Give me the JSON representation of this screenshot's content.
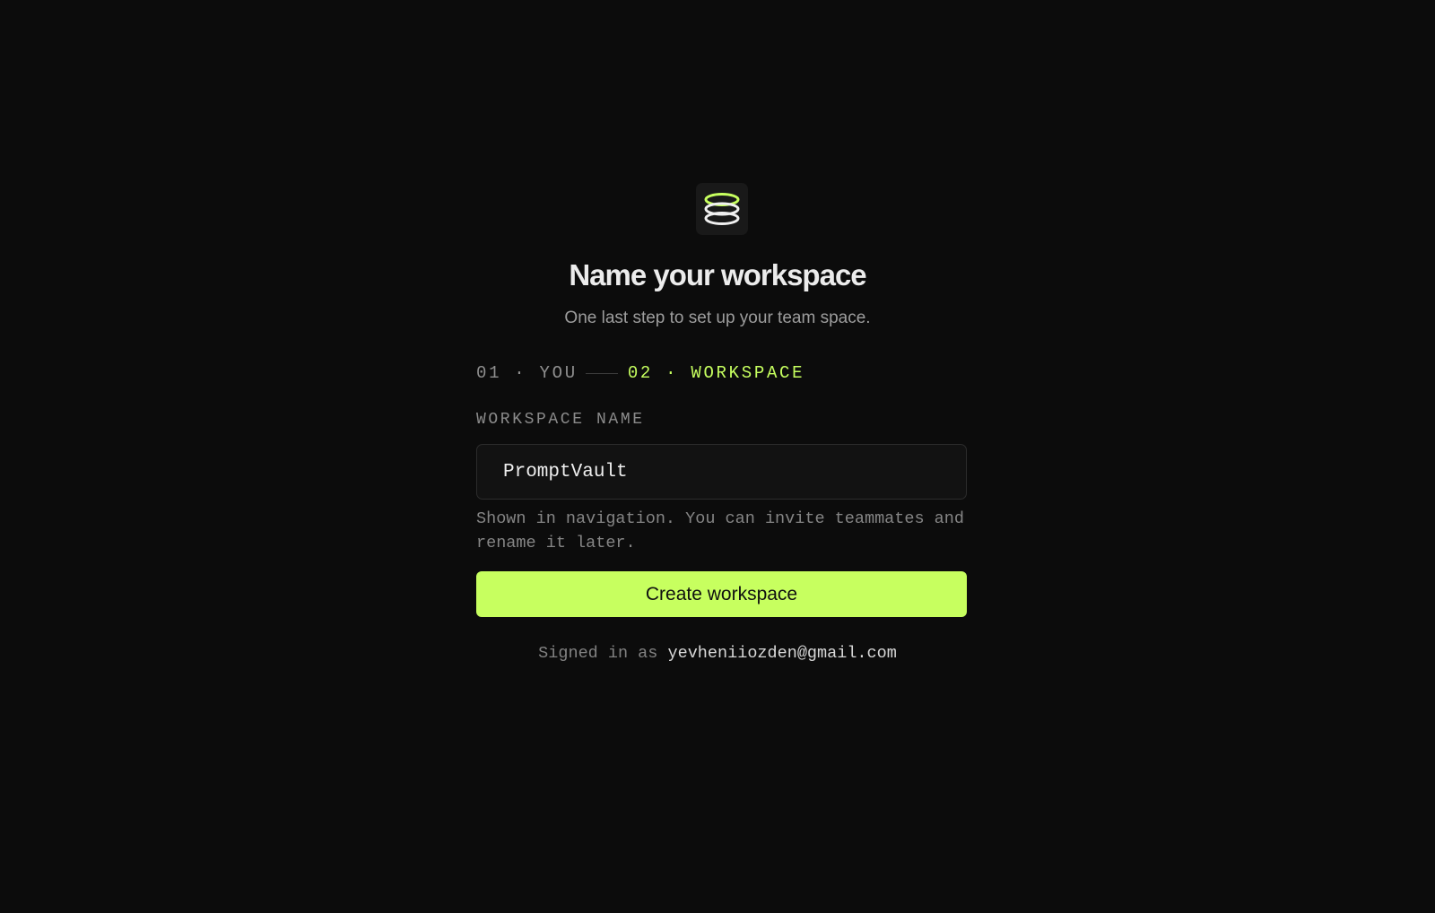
{
  "brand": {
    "logo_icon": "stacked-rings-icon",
    "accent_color": "#c7ff5f"
  },
  "header": {
    "title": "Name your workspace",
    "subtitle": "One last step to set up your team space."
  },
  "steps": [
    {
      "label": "01 · YOU",
      "state": "completed"
    },
    {
      "label": "02 · WORKSPACE",
      "state": "current"
    }
  ],
  "form": {
    "workspace_label": "WORKSPACE NAME",
    "workspace_value": "PromptVault",
    "workspace_hint": "Shown in navigation. You can invite teammates and rename it later.",
    "submit_label": "Create workspace"
  },
  "footer": {
    "signed_in_prefix": "Signed in as",
    "email": "yevheniiozden@gmail.com"
  }
}
